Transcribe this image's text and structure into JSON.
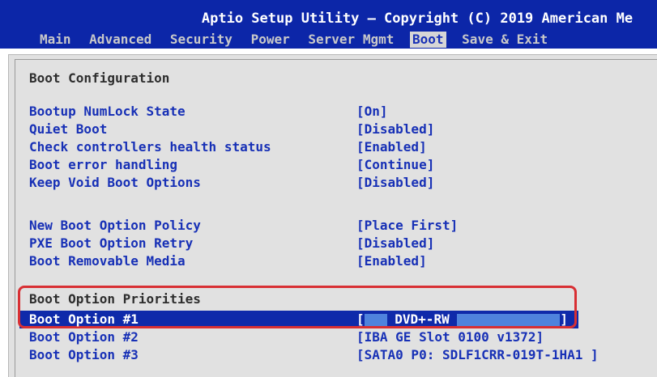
{
  "header": {
    "title": "Aptio Setup Utility – Copyright (C) 2019 American Me",
    "tabs": [
      {
        "label": "Main"
      },
      {
        "label": "Advanced"
      },
      {
        "label": "Security"
      },
      {
        "label": "Power"
      },
      {
        "label": "Server Mgmt"
      },
      {
        "label": "Boot"
      },
      {
        "label": "Save & Exit"
      }
    ],
    "active_tab": "Boot"
  },
  "content": {
    "section_title": "Boot Configuration",
    "settings": [
      {
        "label": "Bootup NumLock State",
        "value": "[On]"
      },
      {
        "label": "Quiet Boot",
        "value": "[Disabled]"
      },
      {
        "label": "Check controllers health status",
        "value": "[Enabled]"
      },
      {
        "label": "Boot error handling",
        "value": "[Continue]"
      },
      {
        "label": "Keep Void Boot Options",
        "value": "[Disabled]"
      },
      {
        "label": "New Boot Option Policy",
        "value": "[Place First]"
      },
      {
        "label": "PXE Boot Option Retry",
        "value": "[Disabled]"
      },
      {
        "label": "Boot Removable Media",
        "value": "[Enabled]"
      }
    ],
    "priorities_title": "Boot Option Priorities",
    "boot_options": [
      {
        "label": "Boot Option #1",
        "value_prefix": "[",
        "value_mid": " DVD+-RW ",
        "value_suffix": "]"
      },
      {
        "label": "Boot Option #2",
        "value": "[IBA GE Slot 0100 v1372]"
      },
      {
        "label": "Boot Option #3",
        "value": "[SATA0 P0: SDLF1CRR-019T-1HA1  ]"
      }
    ]
  },
  "colors": {
    "title_bg": "#0c26a8",
    "panel_bg": "#e1e1e1",
    "option_text": "#1730b6",
    "highlight": "#d82f33"
  }
}
